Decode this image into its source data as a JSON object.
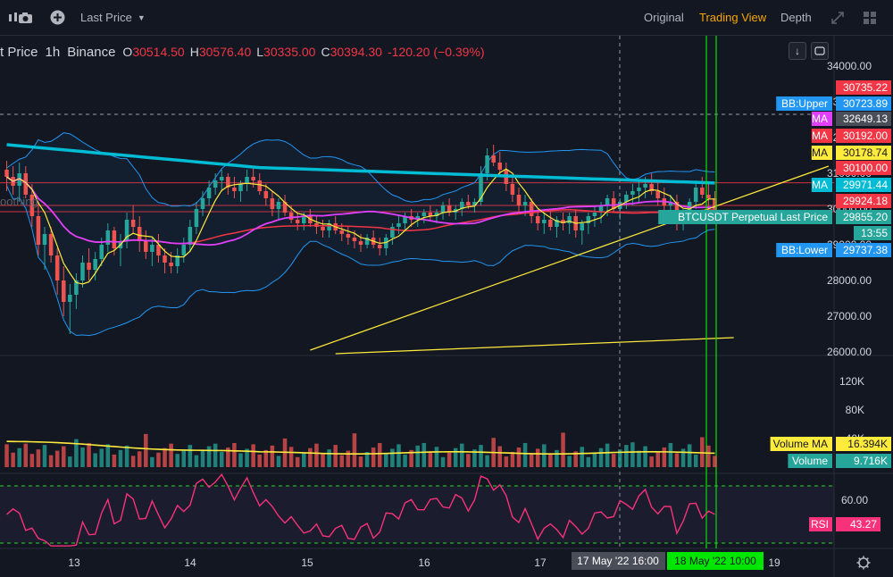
{
  "toolbar": {
    "price_type": "Last Price",
    "views": [
      "Original",
      "Trading View",
      "Depth"
    ],
    "active_view": "Trading View"
  },
  "legend": {
    "symbol_fragment": "t Price",
    "interval": "1h",
    "exchange": "Binance",
    "open_key": "O",
    "open": "30514.50",
    "high_key": "H",
    "high": "30576.40",
    "low_key": "L",
    "low": "30335.00",
    "close_key": "C",
    "close": "30394.30",
    "change": "-120.20 (−0.39%)"
  },
  "watermark_fragment": "oothing",
  "colors": {
    "up": "#26a69a",
    "down": "#ef5350",
    "accent": "#f7a600",
    "ma_cyan": "#40c4ff",
    "ma_magenta": "#e040fb",
    "ma_yellow": "#ffeb3b",
    "rsi": "#f7327a",
    "background": "#131722"
  },
  "chart_data": [
    {
      "type": "candlestick",
      "title": "BTCUSDT Perpetual 1h",
      "x_ticks": [
        "13",
        "14",
        "15",
        "16",
        "17",
        "19"
      ],
      "y_ticks": [
        34000,
        33000,
        32000,
        31000,
        30000,
        29000,
        28000,
        27000,
        26000
      ],
      "ylim": [
        25900,
        34700
      ],
      "crosshair": {
        "x_label": "17 May '22  16:00",
        "y_value": 32649.13
      },
      "time_marker": "18 May '22  10:00",
      "countdown": "13:55",
      "price_labels": [
        {
          "name": "",
          "value": "30735.22",
          "color": "#f23645"
        },
        {
          "name": "BB:Upper",
          "value": "30723.89",
          "color": "#2196f3"
        },
        {
          "name": "MA",
          "value": "32649.13",
          "color": "#e040fb",
          "is_crosshair": true
        },
        {
          "name": "MA",
          "value": "30192.00",
          "color": "#f23645"
        },
        {
          "name": "MA",
          "value": "30178.74",
          "color": "#ffeb3b"
        },
        {
          "name": "",
          "value": "30100.00",
          "color": "#f23645"
        },
        {
          "name": "MA",
          "value": "29971.44",
          "color": "#00bcd4"
        },
        {
          "name": "",
          "value": "29924.18",
          "color": "#f23645"
        },
        {
          "name": "BTCUSDT Perpetual Last Price",
          "value": "29855.20",
          "color": "#26a69a"
        },
        {
          "name": "BB:Lower",
          "value": "29737.38",
          "color": "#2196f3"
        }
      ],
      "horizontal_lines": [
        30735.22,
        30100.0,
        29924.18
      ],
      "candles_ohlc": [
        [
          31100,
          31350,
          30500,
          30900
        ],
        [
          30900,
          31200,
          30400,
          30650
        ],
        [
          30650,
          31300,
          30200,
          31000
        ],
        [
          31000,
          31200,
          30300,
          30400
        ],
        [
          30400,
          30700,
          29500,
          29800
        ],
        [
          29800,
          30200,
          28700,
          29000
        ],
        [
          29000,
          29500,
          28300,
          29300
        ],
        [
          29300,
          29500,
          28500,
          28700
        ],
        [
          28700,
          28900,
          27600,
          28000
        ],
        [
          28000,
          28400,
          27000,
          27400
        ],
        [
          27400,
          27900,
          26500,
          27600
        ],
        [
          27600,
          28200,
          27200,
          28000
        ],
        [
          28000,
          28700,
          27800,
          28500
        ],
        [
          28500,
          28900,
          28000,
          28300
        ],
        [
          28300,
          28800,
          28000,
          28600
        ],
        [
          28600,
          29200,
          28400,
          29000
        ],
        [
          29000,
          29600,
          28800,
          29400
        ],
        [
          29400,
          29500,
          28700,
          28900
        ],
        [
          28900,
          29300,
          28400,
          29100
        ],
        [
          29100,
          29900,
          28900,
          29700
        ],
        [
          29700,
          30100,
          29300,
          29500
        ],
        [
          29500,
          29800,
          28800,
          29100
        ],
        [
          29100,
          29400,
          28600,
          28800
        ],
        [
          28800,
          29200,
          28400,
          29000
        ],
        [
          29000,
          29300,
          28500,
          28700
        ],
        [
          28700,
          28900,
          28200,
          28500
        ],
        [
          28500,
          28800,
          28200,
          28400
        ],
        [
          28400,
          28900,
          28200,
          28700
        ],
        [
          28700,
          29200,
          28500,
          29000
        ],
        [
          29000,
          29700,
          28800,
          29500
        ],
        [
          29500,
          30200,
          29300,
          30000
        ],
        [
          30000,
          30500,
          29800,
          30300
        ],
        [
          30300,
          30800,
          30100,
          30600
        ],
        [
          30600,
          31000,
          30400,
          30800
        ],
        [
          30800,
          31100,
          30500,
          30900
        ],
        [
          30900,
          31000,
          30400,
          30600
        ],
        [
          30600,
          30900,
          30300,
          30500
        ],
        [
          30500,
          30800,
          30200,
          30700
        ],
        [
          30700,
          31100,
          30500,
          30900
        ],
        [
          30900,
          31200,
          30600,
          30800
        ],
        [
          30800,
          31000,
          30400,
          30500
        ],
        [
          30500,
          30700,
          30100,
          30300
        ],
        [
          30300,
          30500,
          29800,
          30000
        ],
        [
          30000,
          30300,
          29700,
          30200
        ],
        [
          30200,
          30400,
          29800,
          29900
        ],
        [
          29900,
          30100,
          29600,
          29700
        ],
        [
          29700,
          29900,
          29400,
          29600
        ],
        [
          29600,
          29900,
          29400,
          29800
        ],
        [
          29800,
          30000,
          29500,
          29600
        ],
        [
          29600,
          29800,
          29300,
          29500
        ],
        [
          29500,
          29700,
          29200,
          29400
        ],
        [
          29400,
          29700,
          29200,
          29600
        ],
        [
          29600,
          29800,
          29300,
          29400
        ],
        [
          29400,
          29600,
          29100,
          29300
        ],
        [
          29300,
          29500,
          29000,
          29200
        ],
        [
          29200,
          29400,
          28900,
          29100
        ],
        [
          29100,
          29300,
          28800,
          29000
        ],
        [
          29000,
          29300,
          28900,
          29200
        ],
        [
          29200,
          29400,
          28900,
          29000
        ],
        [
          29000,
          29200,
          28700,
          28900
        ],
        [
          28900,
          29300,
          28700,
          29200
        ],
        [
          29200,
          29600,
          29000,
          29500
        ],
        [
          29500,
          29800,
          29300,
          29600
        ],
        [
          29600,
          29900,
          29400,
          29800
        ],
        [
          29800,
          30000,
          29500,
          29700
        ],
        [
          29700,
          29900,
          29500,
          29800
        ],
        [
          29800,
          30000,
          29600,
          29900
        ],
        [
          29900,
          30100,
          29700,
          29800
        ],
        [
          29800,
          30000,
          29600,
          29900
        ],
        [
          29900,
          30200,
          29700,
          30100
        ],
        [
          30100,
          30300,
          29800,
          29900
        ],
        [
          29900,
          30100,
          29700,
          30000
        ],
        [
          30000,
          30300,
          29800,
          30200
        ],
        [
          30200,
          30400,
          30000,
          30100
        ],
        [
          30100,
          30300,
          29900,
          30200
        ],
        [
          30200,
          31200,
          30100,
          31000
        ],
        [
          31000,
          31700,
          30800,
          31500
        ],
        [
          31500,
          31800,
          31200,
          31300
        ],
        [
          31300,
          31600,
          30900,
          31100
        ],
        [
          31100,
          31300,
          30500,
          30700
        ],
        [
          30700,
          30900,
          30200,
          30400
        ],
        [
          30400,
          30600,
          29900,
          30100
        ],
        [
          30100,
          30400,
          29800,
          30200
        ],
        [
          30200,
          30300,
          29600,
          29800
        ],
        [
          29800,
          30000,
          29400,
          29600
        ],
        [
          29600,
          29900,
          29300,
          29700
        ],
        [
          29700,
          30000,
          29400,
          29500
        ],
        [
          29500,
          29800,
          29200,
          29700
        ],
        [
          29700,
          29900,
          29400,
          29600
        ],
        [
          29600,
          29900,
          29300,
          29800
        ],
        [
          29800,
          30000,
          29200,
          29400
        ],
        [
          29400,
          29700,
          29000,
          29600
        ],
        [
          29600,
          29900,
          29300,
          29800
        ],
        [
          29800,
          30100,
          29500,
          29900
        ],
        [
          29900,
          30200,
          29600,
          30100
        ],
        [
          30100,
          30400,
          29800,
          30300
        ],
        [
          30300,
          30500,
          29900,
          30000
        ],
        [
          30000,
          30300,
          29700,
          30200
        ],
        [
          30200,
          30500,
          30000,
          30400
        ],
        [
          30400,
          30700,
          30100,
          30500
        ],
        [
          30500,
          30800,
          30200,
          30600
        ],
        [
          30600,
          30900,
          30300,
          30700
        ],
        [
          30700,
          31000,
          30400,
          30500
        ],
        [
          30500,
          30800,
          30100,
          30300
        ],
        [
          30300,
          30600,
          29900,
          30100
        ],
        [
          30100,
          30400,
          29800,
          30200
        ],
        [
          30200,
          30400,
          29400,
          29600
        ],
        [
          29600,
          30000,
          29400,
          29900
        ],
        [
          29900,
          30300,
          29700,
          30200
        ],
        [
          30200,
          30800,
          30000,
          30600
        ],
        [
          30600,
          30900,
          30300,
          30400
        ],
        [
          30400,
          30700,
          30000,
          30300
        ],
        [
          30300,
          30500,
          29800,
          29900
        ]
      ],
      "series": [
        {
          "name": "MA",
          "color": "#00bcd4"
        },
        {
          "name": "MA",
          "color": "#f23645"
        },
        {
          "name": "MA",
          "color": "#e040fb"
        },
        {
          "name": "MA",
          "color": "#ffeb3b"
        },
        {
          "name": "BB:Upper",
          "color": "#2196f3"
        },
        {
          "name": "BB:Lower",
          "color": "#2196f3"
        }
      ],
      "trendlines": [
        {
          "color": "#ffeb3b",
          "from": [
            48,
            26050
          ],
          "to": [
            130,
            31200
          ]
        },
        {
          "color": "#ffeb3b",
          "from": [
            52,
            25950
          ],
          "to": [
            115,
            26400
          ]
        }
      ]
    },
    {
      "type": "bar",
      "title": "Volume",
      "y_ticks": [
        "120K",
        "80K",
        "40K"
      ],
      "ylim": [
        0,
        140000
      ],
      "labels": [
        {
          "name": "Volume MA",
          "value": "16.394K",
          "color": "#ffeb3b"
        },
        {
          "name": "Volume",
          "value": "9.716K",
          "color": "#26a69a"
        }
      ]
    },
    {
      "type": "line",
      "title": "RSI",
      "y_ticks": [
        60.0
      ],
      "ylim": [
        20,
        85
      ],
      "levels": [
        70,
        30
      ],
      "labels": [
        {
          "name": "RSI",
          "value": "43.27",
          "color": "#f7327a"
        }
      ]
    }
  ]
}
